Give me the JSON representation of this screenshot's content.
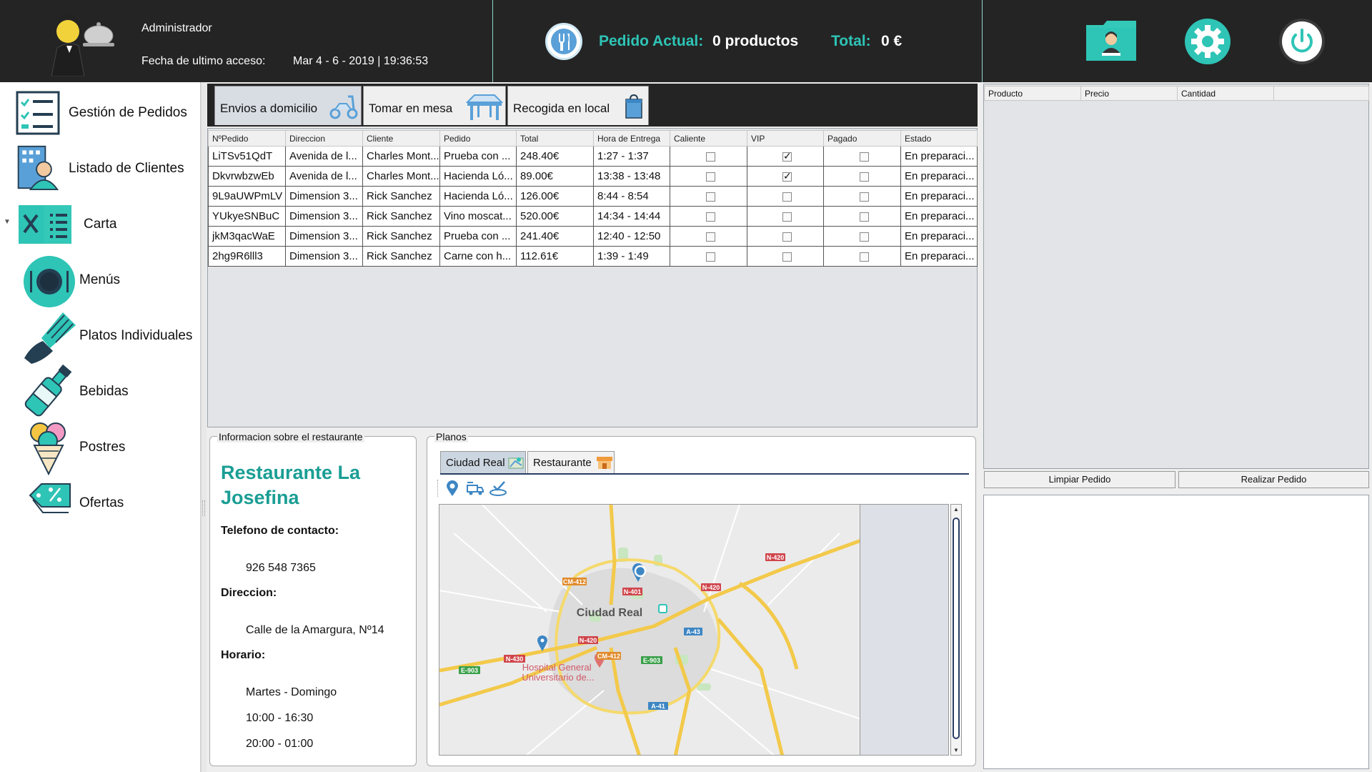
{
  "header": {
    "user_name": "Administrador",
    "last_access_label": "Fecha de ultimo acceso:",
    "last_access_value": "Mar 4 - 6 - 2019 | 19:36:53",
    "order_label": "Pedido Actual:",
    "order_value": "0 productos",
    "total_label": "Total:",
    "total_value": "0 €",
    "icons": [
      "waiter-logo",
      "cutlery-icon",
      "user-folder-icon",
      "gear-icon",
      "power-icon"
    ],
    "accent_color": "#2ec4b6"
  },
  "sidebar": {
    "items": [
      {
        "label": "Gestión de Pedidos",
        "icon": "checklist-icon"
      },
      {
        "label": "Listado de Clientes",
        "icon": "clients-icon"
      },
      {
        "label": "Carta",
        "icon": "menu-card-icon"
      },
      {
        "label": "Menús",
        "icon": "plate-icon"
      },
      {
        "label": "Platos Individuales",
        "icon": "dish-icon"
      },
      {
        "label": "Bebidas",
        "icon": "bottle-icon"
      },
      {
        "label": "Postres",
        "icon": "ice-cream-icon"
      },
      {
        "label": "Ofertas",
        "icon": "discount-tag-icon"
      }
    ]
  },
  "tabs": [
    {
      "label": "Envios a domicilio",
      "icon": "scooter-icon",
      "active": true
    },
    {
      "label": "Tomar en mesa",
      "icon": "table-icon",
      "active": false
    },
    {
      "label": "Recogida en local",
      "icon": "bag-icon",
      "active": false
    }
  ],
  "orders": {
    "columns": [
      "NºPedido",
      "Direccion",
      "Cliente",
      "Pedido",
      "Total",
      "Hora de Entrega",
      "Caliente",
      "VIP",
      "Pagado",
      "Estado"
    ],
    "rows": [
      {
        "id": "LiTSv51QdT",
        "direccion": "Avenida de l...",
        "cliente": "Charles Mont...",
        "pedido": "Prueba con ...",
        "total": "248.40€",
        "hora": "1:27 - 1:37",
        "caliente": false,
        "vip": true,
        "pagado": false,
        "estado": "En preparaci..."
      },
      {
        "id": "DkvrwbzwEb",
        "direccion": "Avenida de l...",
        "cliente": "Charles Mont...",
        "pedido": "Hacienda Ló...",
        "total": "89.00€",
        "hora": "13:38 - 13:48",
        "caliente": false,
        "vip": true,
        "pagado": false,
        "estado": "En preparaci..."
      },
      {
        "id": "9L9aUWPmLV",
        "direccion": "Dimension 3...",
        "cliente": "Rick Sanchez",
        "pedido": "Hacienda Ló...",
        "total": "126.00€",
        "hora": "8:44 - 8:54",
        "caliente": false,
        "vip": false,
        "pagado": false,
        "estado": "En preparaci..."
      },
      {
        "id": "YUkyeSNBuC",
        "direccion": "Dimension 3...",
        "cliente": "Rick Sanchez",
        "pedido": "Vino moscat...",
        "total": "520.00€",
        "hora": "14:34 - 14:44",
        "caliente": false,
        "vip": false,
        "pagado": false,
        "estado": "En preparaci..."
      },
      {
        "id": "jkM3qacWaE",
        "direccion": "Dimension 3...",
        "cliente": "Rick Sanchez",
        "pedido": "Prueba con ...",
        "total": "241.40€",
        "hora": "12:40 - 12:50",
        "caliente": false,
        "vip": false,
        "pagado": false,
        "estado": "En preparaci..."
      },
      {
        "id": "2hg9R6lll3",
        "direccion": "Dimension 3...",
        "cliente": "Rick Sanchez",
        "pedido": "Carne con h...",
        "total": "112.61€",
        "hora": "1:39 - 1:49",
        "caliente": false,
        "vip": false,
        "pagado": false,
        "estado": "En preparaci..."
      }
    ]
  },
  "info": {
    "title": "Informacion sobre el restaurante",
    "name": "Restaurante La Josefina",
    "phone_label": "Telefono de contacto:",
    "phone": "926 548 7365",
    "address_label": "Direccion:",
    "address": "Calle de la Amargura, Nº14",
    "hours_label": "Horario:",
    "days": "Martes - Domingo",
    "hours_1": "10:00 - 16:30",
    "hours_2": "20:00 - 01:00"
  },
  "planos": {
    "title": "Planos",
    "tabs": [
      {
        "label": "Ciudad Real",
        "active": true
      },
      {
        "label": "Restaurante",
        "active": false
      }
    ],
    "tools": [
      "location-pin-icon",
      "delivery-route-icon",
      "check-location-icon"
    ],
    "map": {
      "city": "Ciudad Real",
      "poi": "Hospital General Universitario de...",
      "roads": [
        "N-420",
        "N-420",
        "N-420",
        "N-401",
        "CM-412",
        "CM-412",
        "A-43",
        "N-430",
        "E-903",
        "E-903",
        "A-41"
      ]
    }
  },
  "cart": {
    "columns": [
      "Producto",
      "Precio",
      "Cantidad",
      ""
    ],
    "clear_label": "Limpiar Pedido",
    "submit_label": "Realizar Pedido"
  }
}
